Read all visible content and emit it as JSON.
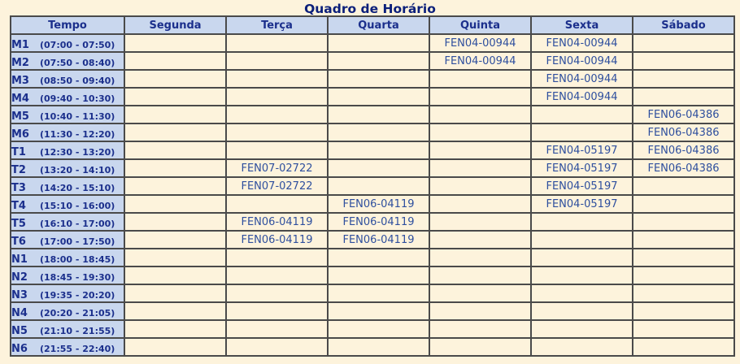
{
  "title": "Quadro de Horário",
  "columns": [
    "Tempo",
    "Segunda",
    "Terça",
    "Quarta",
    "Quinta",
    "Sexta",
    "Sábado"
  ],
  "rows": [
    {
      "code": "M1",
      "range": "(07:00 - 07:50)",
      "cells": [
        "",
        "",
        "",
        "FEN04-00944",
        "FEN04-00944",
        ""
      ]
    },
    {
      "code": "M2",
      "range": "(07:50 - 08:40)",
      "cells": [
        "",
        "",
        "",
        "FEN04-00944",
        "FEN04-00944",
        ""
      ]
    },
    {
      "code": "M3",
      "range": "(08:50 - 09:40)",
      "cells": [
        "",
        "",
        "",
        "",
        "FEN04-00944",
        ""
      ]
    },
    {
      "code": "M4",
      "range": "(09:40 - 10:30)",
      "cells": [
        "",
        "",
        "",
        "",
        "FEN04-00944",
        ""
      ]
    },
    {
      "code": "M5",
      "range": "(10:40 - 11:30)",
      "cells": [
        "",
        "",
        "",
        "",
        "",
        "FEN06-04386"
      ]
    },
    {
      "code": "M6",
      "range": "(11:30 - 12:20)",
      "cells": [
        "",
        "",
        "",
        "",
        "",
        "FEN06-04386"
      ]
    },
    {
      "code": "T1",
      "range": "(12:30 - 13:20)",
      "cells": [
        "",
        "",
        "",
        "",
        "FEN04-05197",
        "FEN06-04386"
      ]
    },
    {
      "code": "T2",
      "range": "(13:20 - 14:10)",
      "cells": [
        "",
        "FEN07-02722",
        "",
        "",
        "FEN04-05197",
        "FEN06-04386"
      ]
    },
    {
      "code": "T3",
      "range": "(14:20 - 15:10)",
      "cells": [
        "",
        "FEN07-02722",
        "",
        "",
        "FEN04-05197",
        ""
      ]
    },
    {
      "code": "T4",
      "range": "(15:10 - 16:00)",
      "cells": [
        "",
        "",
        "FEN06-04119",
        "",
        "FEN04-05197",
        ""
      ]
    },
    {
      "code": "T5",
      "range": "(16:10 - 17:00)",
      "cells": [
        "",
        "FEN06-04119",
        "FEN06-04119",
        "",
        "",
        ""
      ]
    },
    {
      "code": "T6",
      "range": "(17:00 - 17:50)",
      "cells": [
        "",
        "FEN06-04119",
        "FEN06-04119",
        "",
        "",
        ""
      ]
    },
    {
      "code": "N1",
      "range": "(18:00 - 18:45)",
      "cells": [
        "",
        "",
        "",
        "",
        "",
        ""
      ]
    },
    {
      "code": "N2",
      "range": "(18:45 - 19:30)",
      "cells": [
        "",
        "",
        "",
        "",
        "",
        ""
      ]
    },
    {
      "code": "N3",
      "range": "(19:35 - 20:20)",
      "cells": [
        "",
        "",
        "",
        "",
        "",
        ""
      ]
    },
    {
      "code": "N4",
      "range": "(20:20 - 21:05)",
      "cells": [
        "",
        "",
        "",
        "",
        "",
        ""
      ]
    },
    {
      "code": "N5",
      "range": "(21:10 - 21:55)",
      "cells": [
        "",
        "",
        "",
        "",
        "",
        ""
      ]
    },
    {
      "code": "N6",
      "range": "(21:55 - 22:40)",
      "cells": [
        "",
        "",
        "",
        "",
        "",
        ""
      ]
    }
  ]
}
